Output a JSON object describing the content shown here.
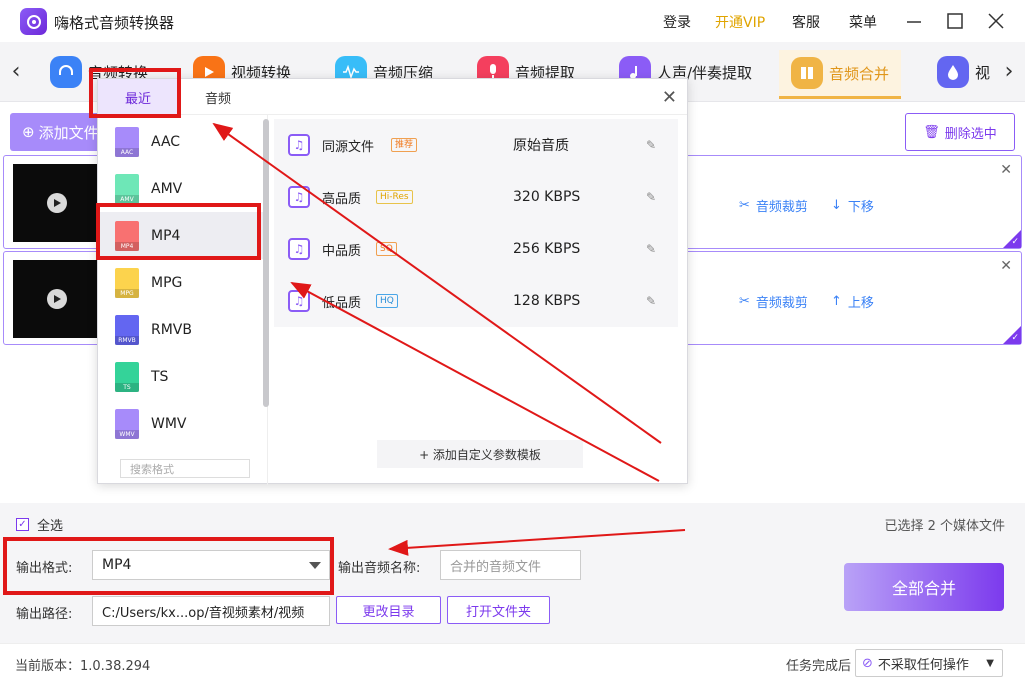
{
  "app": {
    "title": "嗨格式音频转换器",
    "menu": {
      "login": "登录",
      "vip": "开通VIP",
      "service": "客服",
      "menu": "菜单"
    }
  },
  "nav": {
    "tabs": [
      {
        "label": "音频转换",
        "color": "#3b82f6"
      },
      {
        "label": "视频转换",
        "color": "#f97316"
      },
      {
        "label": "音频压缩",
        "color": "#38bdf8"
      },
      {
        "label": "音频提取",
        "color": "#f43f5e"
      },
      {
        "label": "人声/伴奏提取",
        "color": "#8b5cf6"
      },
      {
        "label": "音频合并",
        "color": "#f0b445",
        "active": true
      },
      {
        "label": "视",
        "color": "#6366f1"
      }
    ]
  },
  "toolbar": {
    "add_file": "添加文件",
    "delete_selected": "删除选中"
  },
  "files": [
    {
      "action1": "音频裁剪",
      "action2": "下移"
    },
    {
      "action1": "音频裁剪",
      "action2": "上移"
    }
  ],
  "popup": {
    "tab_recent": "最近",
    "tab_audio": "音频",
    "formats": [
      {
        "name": "AAC",
        "tag": "AAC",
        "color": "#a78bfa"
      },
      {
        "name": "AMV",
        "tag": "AMV",
        "color": "#6ee7b7"
      },
      {
        "name": "MP4",
        "tag": "MP4",
        "color": "#f87171",
        "selected": true
      },
      {
        "name": "MPG",
        "tag": "MPG",
        "color": "#fcd34d"
      },
      {
        "name": "RMVB",
        "tag": "RMVB",
        "color": "#6366f1"
      },
      {
        "name": "TS",
        "tag": "TS",
        "color": "#34d399"
      },
      {
        "name": "WMV",
        "tag": "WMV",
        "color": "#a78bfa"
      }
    ],
    "search_placeholder": "搜索格式",
    "qualities": [
      {
        "name": "同源文件",
        "tag": "推荐",
        "tag_style": "rec",
        "bitrate": "原始音质"
      },
      {
        "name": "高品质",
        "tag": "Hi-Res",
        "tag_style": "hires",
        "bitrate": "320 KBPS"
      },
      {
        "name": "中品质",
        "tag": "SQ",
        "tag_style": "rec",
        "bitrate": "256 KBPS"
      },
      {
        "name": "低品质",
        "tag": "HQ",
        "tag_style": "hq",
        "bitrate": "128 KBPS"
      }
    ],
    "add_template": "+ 添加自定义参数模板"
  },
  "bottom": {
    "select_all": "全选",
    "selected_count": "已选择 2 个媒体文件",
    "output_format_label": "输出格式:",
    "output_format_value": "MP4",
    "output_name_label": "输出音频名称:",
    "output_name_placeholder": "合并的音频文件",
    "output_path_label": "输出路径:",
    "output_path_value": "C:/Users/kx...op/音视频素材/视频",
    "change_dir": "更改目录",
    "open_folder": "打开文件夹",
    "merge_all": "全部合并"
  },
  "status": {
    "version": "当前版本：1.0.38.294",
    "after_task_label": "任务完成后",
    "after_task_value": "不采取任何操作"
  }
}
